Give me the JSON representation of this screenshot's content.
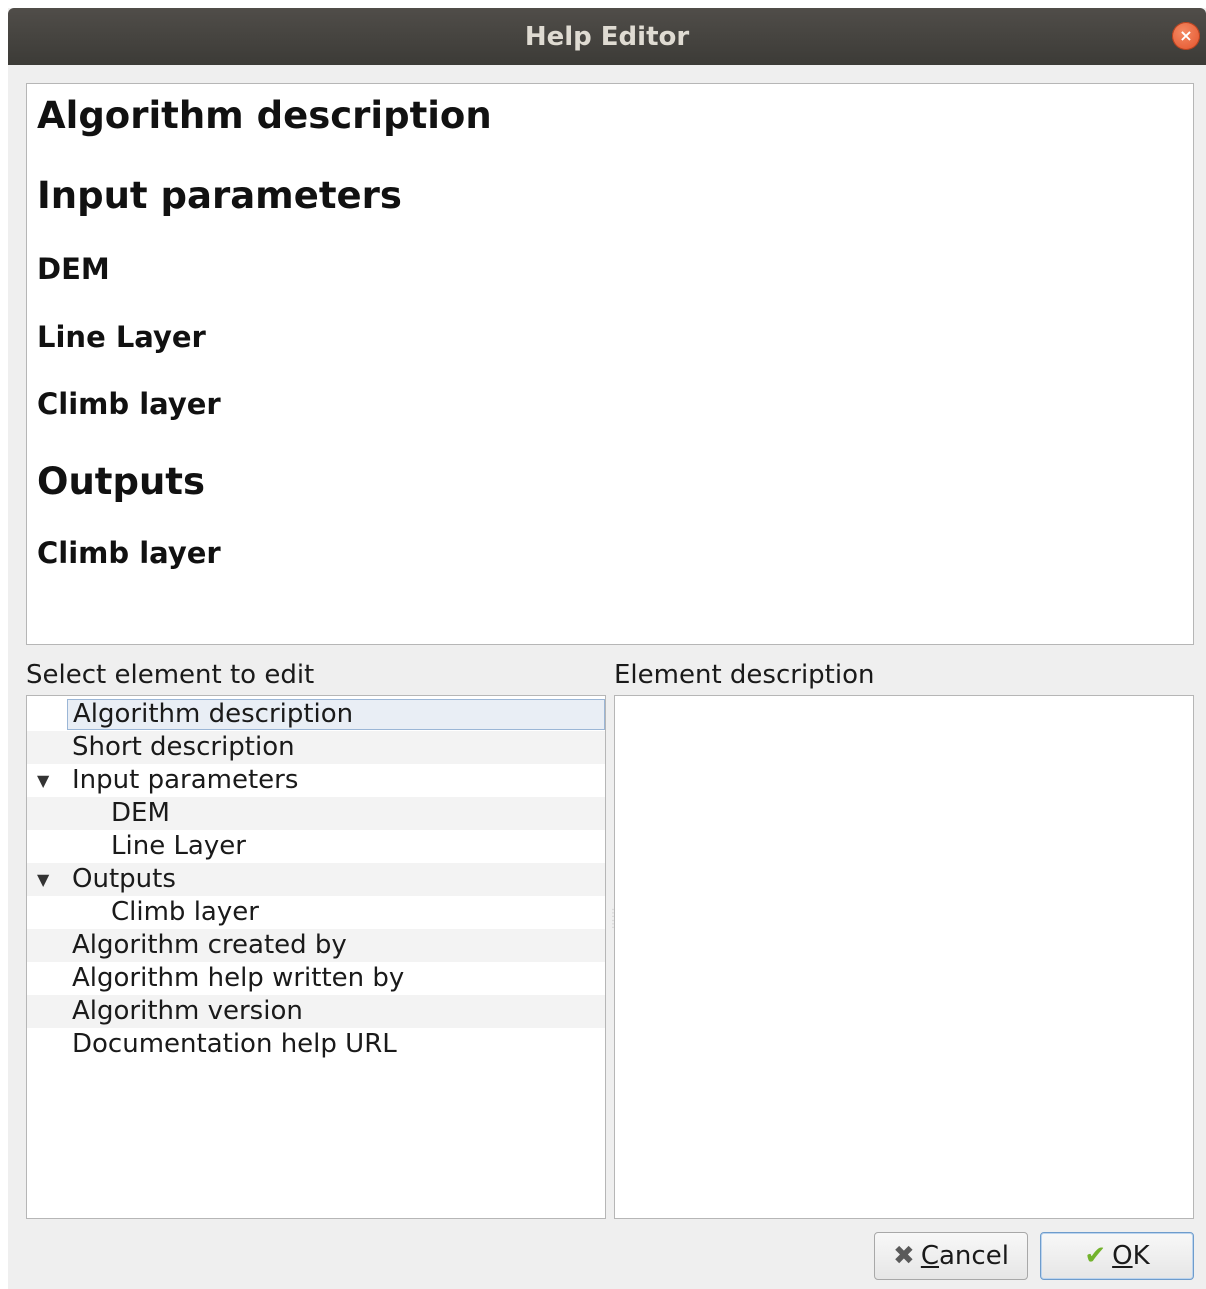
{
  "window": {
    "title": "Help Editor",
    "close_icon": "×"
  },
  "preview": {
    "headings": [
      "Algorithm description",
      "Input parameters",
      "DEM",
      "Line Layer",
      "Climb layer",
      "Outputs",
      "Climb layer"
    ]
  },
  "labels": {
    "select_element": "Select element to edit",
    "element_description": "Element description"
  },
  "tree": {
    "items": [
      {
        "label": "Algorithm description",
        "indent": 0,
        "expander": "",
        "selected": true
      },
      {
        "label": "Short description",
        "indent": 0,
        "expander": ""
      },
      {
        "label": "Input parameters",
        "indent": 0,
        "expander": "▼"
      },
      {
        "label": "DEM",
        "indent": 1,
        "expander": ""
      },
      {
        "label": "Line Layer",
        "indent": 1,
        "expander": ""
      },
      {
        "label": "Outputs",
        "indent": 0,
        "expander": "▼"
      },
      {
        "label": "Climb layer",
        "indent": 1,
        "expander": ""
      },
      {
        "label": "Algorithm created by",
        "indent": 0,
        "expander": ""
      },
      {
        "label": "Algorithm help written by",
        "indent": 0,
        "expander": ""
      },
      {
        "label": "Algorithm version",
        "indent": 0,
        "expander": ""
      },
      {
        "label": "Documentation help URL",
        "indent": 0,
        "expander": ""
      }
    ]
  },
  "element_description": {
    "value": ""
  },
  "buttons": {
    "cancel": {
      "icon": "✖",
      "mnemonic": "C",
      "rest": "ancel",
      "icon_color": "#5a5a5a"
    },
    "ok": {
      "icon": "✔",
      "mnemonic": "O",
      "rest": "K",
      "icon_color": "#73b32d"
    }
  }
}
